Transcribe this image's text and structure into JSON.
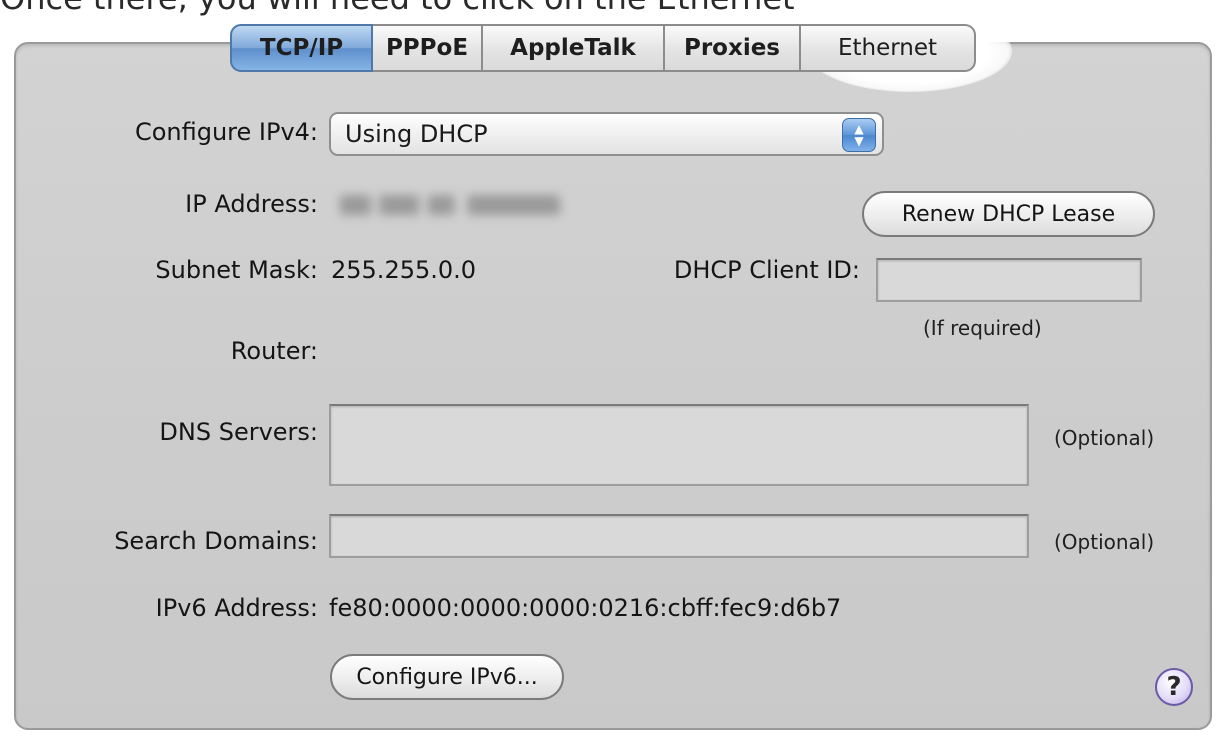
{
  "caption": "Once there, you will need to click on the Ethernet",
  "tabs": [
    {
      "label": "TCP/IP",
      "selected": true
    },
    {
      "label": "PPPoE",
      "selected": false
    },
    {
      "label": "AppleTalk",
      "selected": false
    },
    {
      "label": "Proxies",
      "selected": false
    },
    {
      "label": "Ethernet",
      "selected": false,
      "highlighted": true
    }
  ],
  "configure_ipv4": {
    "label": "Configure IPv4:",
    "value": "Using DHCP"
  },
  "ip_address": {
    "label": "IP Address:"
  },
  "renew_button": "Renew DHCP Lease",
  "subnet_mask": {
    "label": "Subnet Mask:",
    "value": "255.255.0.0"
  },
  "dhcp_client_id": {
    "label": "DHCP Client ID:",
    "value": "",
    "hint": "(If required)"
  },
  "router": {
    "label": "Router:"
  },
  "dns_servers": {
    "label": "DNS Servers:",
    "value": "",
    "hint": "(Optional)"
  },
  "search_domains": {
    "label": "Search Domains:",
    "value": "",
    "hint": "(Optional)"
  },
  "ipv6_address": {
    "label": "IPv6 Address:",
    "value": "fe80:0000:0000:0000:0216:cbff:fec9:d6b7"
  },
  "configure_ipv6_button": "Configure IPv6...",
  "help_button": "?",
  "colors": {
    "panel_bg": "#cdcdcd",
    "selected_tab": "#6d9bd3",
    "help_ring": "#6b5aa8"
  },
  "icons": {
    "select_arrows": "up-down-arrows-icon",
    "help": "question-mark-icon"
  }
}
